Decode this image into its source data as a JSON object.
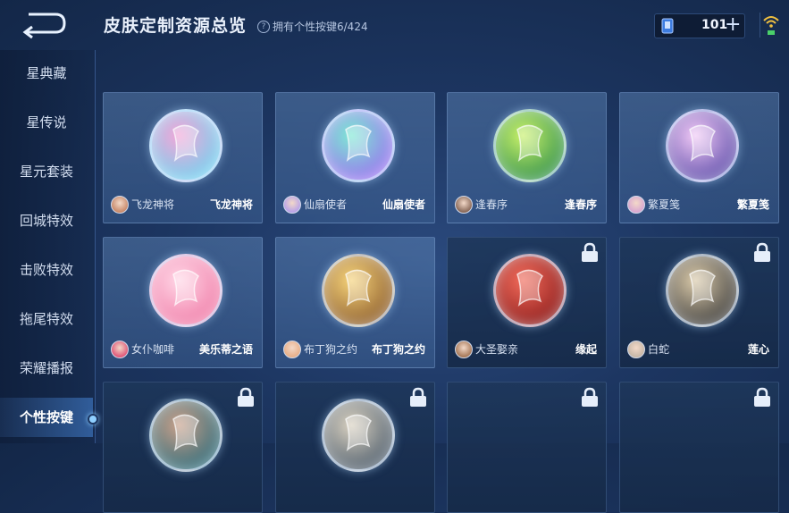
{
  "header": {
    "title": "皮肤定制资源总览",
    "count_label": "拥有个性按键6/424",
    "currency_amount": "101",
    "currency_plus": "+"
  },
  "sidebar": {
    "items": [
      {
        "label": "星典藏"
      },
      {
        "label": "星传说"
      },
      {
        "label": "星元套装"
      },
      {
        "label": "回城特效"
      },
      {
        "label": "击败特效"
      },
      {
        "label": "拖尾特效"
      },
      {
        "label": "荣耀播报"
      },
      {
        "label": "个性按键",
        "active": true
      }
    ]
  },
  "cards": [
    {
      "hero": "飞龙神将",
      "skin": "飞龙神将",
      "locked": false,
      "orb": [
        "#f2a7d8",
        "#6fd3f0"
      ],
      "avatar": "#c98a6b"
    },
    {
      "hero": "仙扇使者",
      "skin": "仙扇使者",
      "locked": false,
      "orb": [
        "#7ee8d4",
        "#9b6ff0"
      ],
      "avatar": "#b9a3e8"
    },
    {
      "hero": "逢春序",
      "skin": "逢春序",
      "locked": false,
      "orb": [
        "#c8f06a",
        "#2e8f4a"
      ],
      "avatar": "#8a6a5a"
    },
    {
      "hero": "繁夏笺",
      "skin": "繁夏笺",
      "locked": false,
      "orb": [
        "#f0c8f5",
        "#5a4aa8"
      ],
      "avatar": "#d9a8d0"
    },
    {
      "hero": "女仆咖啡",
      "skin": "美乐蒂之语",
      "locked": false,
      "orb": [
        "#ffd6e6",
        "#f07aa6"
      ],
      "avatar": "#e05a7a"
    },
    {
      "hero": "布丁狗之约",
      "skin": "布丁狗之约",
      "locked": false,
      "orb": [
        "#f5d27a",
        "#8a5a2a"
      ],
      "avatar": "#e8b08a"
    },
    {
      "hero": "大圣娶亲",
      "skin": "缘起",
      "locked": true,
      "orb": [
        "#f06a5a",
        "#8a1a1a"
      ],
      "avatar": "#a87a5a"
    },
    {
      "hero": "白蛇",
      "skin": "莲心",
      "locked": true,
      "orb": [
        "#d8c8a8",
        "#3a3a3a"
      ],
      "avatar": "#c8b8a8"
    },
    {
      "hero": "",
      "skin": "",
      "locked": true,
      "orb": [
        "#c8a08a",
        "#2a6a7a"
      ],
      "avatar": ""
    },
    {
      "hero": "",
      "skin": "",
      "locked": true,
      "orb": [
        "#d8d0c0",
        "#4a5a6a"
      ],
      "avatar": ""
    },
    {
      "hero": "",
      "skin": "",
      "locked": true,
      "orb": null,
      "avatar": ""
    },
    {
      "hero": "",
      "skin": "",
      "locked": true,
      "orb": null,
      "avatar": ""
    }
  ],
  "icons": {
    "back": "back-arrow-icon",
    "help": "question-icon",
    "currency": "gem-card-icon",
    "signal": "wifi-signal-icon",
    "lock": "lock-icon"
  }
}
